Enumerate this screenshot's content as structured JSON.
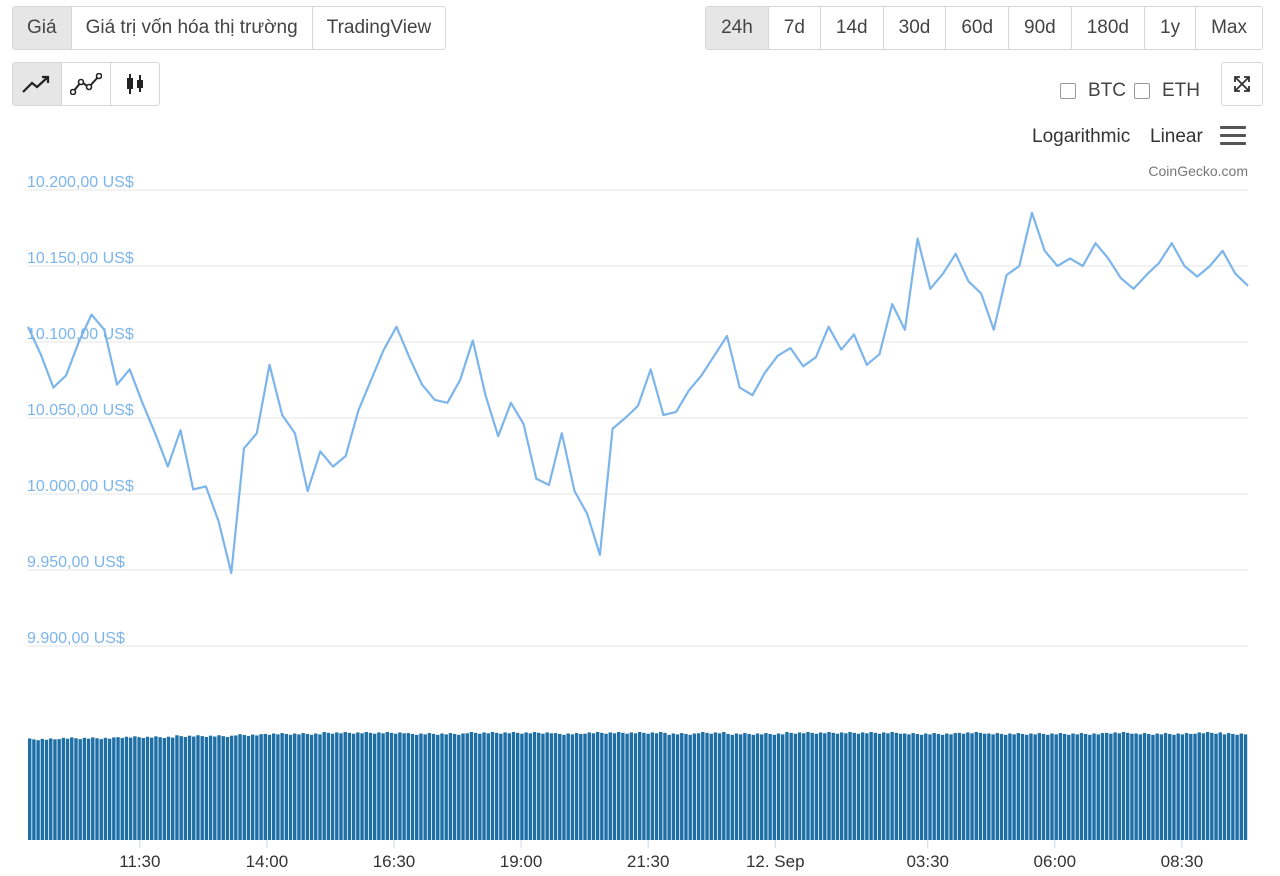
{
  "tabs": [
    {
      "label": "Giá",
      "active": true
    },
    {
      "label": "Giá trị vốn hóa thị trường",
      "active": false
    },
    {
      "label": "TradingView",
      "active": false
    }
  ],
  "ranges": [
    {
      "label": "24h",
      "active": true
    },
    {
      "label": "7d",
      "active": false
    },
    {
      "label": "14d",
      "active": false
    },
    {
      "label": "30d",
      "active": false
    },
    {
      "label": "60d",
      "active": false
    },
    {
      "label": "90d",
      "active": false
    },
    {
      "label": "180d",
      "active": false
    },
    {
      "label": "1y",
      "active": false
    },
    {
      "label": "Max",
      "active": false
    }
  ],
  "chart_types": [
    {
      "name": "line-chart-icon",
      "active": true
    },
    {
      "name": "point-line-icon",
      "active": false
    },
    {
      "name": "candlestick-icon",
      "active": false
    }
  ],
  "compare": {
    "btc": "BTC",
    "eth": "ETH"
  },
  "scale": {
    "log": "Logarithmic",
    "linear": "Linear"
  },
  "credit": "CoinGecko.com",
  "colors": {
    "line": "#7cb5ec",
    "volume": "#1d6fa5",
    "grid": "#e6e6e6"
  },
  "chart_data": {
    "type": "line",
    "title": "",
    "xlabel": "",
    "ylabel": "",
    "ylim": [
      9900,
      10200
    ],
    "y_ticks": [
      "10.200,00 US$",
      "10.150,00 US$",
      "10.100,00 US$",
      "10.050,00 US$",
      "10.000,00 US$",
      "9.950,00 US$",
      "9.900,00 US$"
    ],
    "y_tick_values": [
      10200,
      10150,
      10100,
      10050,
      10000,
      9950,
      9900
    ],
    "x_ticks": [
      "11:30",
      "14:00",
      "16:30",
      "19:00",
      "21:30",
      "12. Sep",
      "03:30",
      "06:00",
      "08:30"
    ],
    "x_tick_hours": [
      2.2,
      4.7,
      7.2,
      9.7,
      12.2,
      14.7,
      17.7,
      20.2,
      22.7
    ],
    "x_range_hours": [
      0,
      24
    ],
    "price_series": {
      "x": [
        0,
        0.25,
        0.5,
        0.75,
        1.0,
        1.25,
        1.5,
        1.75,
        2.0,
        2.25,
        2.5,
        2.75,
        3.0,
        3.25,
        3.5,
        3.75,
        4.0,
        4.25,
        4.5,
        4.75,
        5.0,
        5.25,
        5.5,
        5.75,
        6.0,
        6.25,
        6.5,
        6.75,
        7.0,
        7.25,
        7.5,
        7.75,
        8.0,
        8.25,
        8.5,
        8.75,
        9.0,
        9.25,
        9.5,
        9.75,
        10.0,
        10.25,
        10.5,
        10.75,
        11.0,
        11.25,
        11.5,
        11.75,
        12.0,
        12.25,
        12.5,
        12.75,
        13.0,
        13.25,
        13.5,
        13.75,
        14.0,
        14.25,
        14.5,
        14.75,
        15.0,
        15.25,
        15.5,
        15.75,
        16.0,
        16.25,
        16.5,
        16.75,
        17.0,
        17.25,
        17.5,
        17.75,
        18.0,
        18.25,
        18.5,
        18.75,
        19.0,
        19.25,
        19.5,
        19.75,
        20.0,
        20.25,
        20.5,
        20.75,
        21.0,
        21.25,
        21.5,
        21.75,
        22.0,
        22.25,
        22.5,
        22.75,
        23.0,
        23.25,
        23.5,
        23.75,
        24.0
      ],
      "y": [
        10110,
        10092,
        10070,
        10078,
        10100,
        10118,
        10108,
        10072,
        10082,
        10060,
        10040,
        10018,
        10042,
        10003,
        10005,
        9982,
        9948,
        10030,
        10040,
        10085,
        10052,
        10040,
        10002,
        10028,
        10018,
        10025,
        10055,
        10075,
        10095,
        10110,
        10090,
        10072,
        10062,
        10060,
        10075,
        10101,
        10065,
        10038,
        10060,
        10046,
        10010,
        10006,
        10040,
        10002,
        9987,
        9960,
        10043,
        10050,
        10058,
        10082,
        10052,
        10054,
        10068,
        10078,
        10091,
        10104,
        10070,
        10065,
        10080,
        10091,
        10096,
        10084,
        10090,
        10110,
        10095,
        10105,
        10085,
        10092,
        10125,
        10108,
        10168,
        10135,
        10145,
        10158,
        10140,
        10132,
        10108,
        10144,
        10150,
        10185,
        10160,
        10150,
        10155,
        10150,
        10165,
        10155,
        10142,
        10135,
        10144,
        10152,
        10165,
        10150,
        10143,
        10150,
        10160,
        10145,
        10137
      ]
    },
    "volume_series": {
      "values_relative": [
        0.94,
        0.95,
        0.95,
        0.96,
        0.96,
        0.97,
        0.97,
        0.98,
        0.99,
        0.99,
        1.0,
        1.0,
        1.0,
        0.99,
        0.99,
        1.0,
        1.0,
        1.0,
        0.99,
        1.0,
        1.0,
        1.0,
        0.99,
        1.0,
        0.99,
        0.99,
        1.0,
        1.0,
        1.0,
        1.0,
        0.99,
        0.99,
        1.0,
        0.99,
        0.99,
        0.99,
        0.99,
        1.0,
        0.99,
        0.99,
        1.0,
        0.99
      ]
    }
  }
}
